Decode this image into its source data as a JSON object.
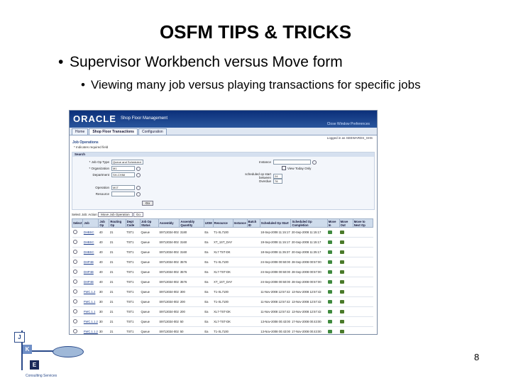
{
  "slide": {
    "title": "OSFM TIPS & TRICKS",
    "bullet1": "Supervisor Workbench versus Move form",
    "bullet2": "Viewing many job versus playing transactions for specific jobs",
    "bullet_char": "•",
    "page_number": "8"
  },
  "app": {
    "logo": "ORACLE",
    "title": "Shop Floor Management",
    "header_links": "Close Window   Preferences",
    "logged_in": "Logged in as  SEEWARDS_SHS",
    "tabs": [
      {
        "label": "Home",
        "active": false
      },
      {
        "label": "Shop Floor Transactions",
        "active": true
      },
      {
        "label": "Configuration",
        "active": false
      }
    ],
    "section_title": "Job Operations",
    "required_note": "* Indicates required field",
    "search": {
      "bar_label": "Search",
      "fields_left": [
        {
          "label": "* Job Op Type",
          "value": "Queue and Scheduled"
        },
        {
          "label": "* Organization",
          "value": "M1"
        },
        {
          "label": "Department",
          "value": "SH-CHIM"
        },
        {
          "label": "Operation",
          "value": "M1T"
        },
        {
          "label": "Resource",
          "value": ""
        }
      ],
      "fields_right": [
        {
          "label": "Instance",
          "value": ""
        },
        {
          "label": "scheduled op  start between",
          "value": "24"
        },
        {
          "label": "Overdue",
          "value": "78"
        }
      ],
      "checkbox_label": "View Today Only",
      "go_label": "Go"
    },
    "select_bar": {
      "label": "Select Job",
      "action_label": "Action",
      "action_value": "Move Job Operation",
      "go_label": "Go"
    },
    "table": {
      "headers": [
        "Select",
        "Job",
        "Job Op",
        "Routing Op",
        "Dept Code",
        "Job Op Status",
        "Assembly",
        "Assembly Quantity",
        "UOM",
        "Resource",
        "Instance",
        "Batch ID",
        "Scheduled Op Start",
        "Scheduled Op Completion",
        "Move In",
        "Move Out",
        "Move to Next Op"
      ],
      "rows": [
        {
          "job": "DHBSC",
          "op": "40",
          "rop": "21",
          "dept": "TST1",
          "status": "Queue",
          "assembly": "S9713034-002",
          "qty": "3180",
          "uom": "Ea",
          "resource": "T1-XL7100",
          "start": "18-Sep-2008 11:15:17",
          "end": "20-Sep-2008 11:15:17"
        },
        {
          "job": "DHBSC",
          "op": "40",
          "rop": "21",
          "dept": "TST1",
          "status": "Queue",
          "assembly": "S9713034-002",
          "qty": "3160",
          "uom": "Ea",
          "resource": "XT_1ST_DAY",
          "start": "19-Sep-2008 11:15:17",
          "end": "20-Sep-2008 11:15:17"
        },
        {
          "job": "DHBSC",
          "op": "40",
          "rop": "21",
          "dept": "TST1",
          "status": "Queue",
          "assembly": "S9713034-002",
          "qty": "3160",
          "uom": "Ea",
          "resource": "XL7 TST-DK",
          "start": "18-Sep-2008 11:35:37",
          "end": "20-Sep-2008 11:25:17"
        },
        {
          "job": "DHP4B",
          "op": "40",
          "rop": "21",
          "dept": "TST1",
          "status": "Queue",
          "assembly": "S9713034-002",
          "qty": "3576",
          "uom": "Ea",
          "resource": "T1-XL7100",
          "start": "24-Sep-2008 00:50:00",
          "end": "28-Sep-2008 00:57:00"
        },
        {
          "job": "DHP4B",
          "op": "40",
          "rop": "21",
          "dept": "TST1",
          "status": "Queue",
          "assembly": "S9713034-002",
          "qty": "3576",
          "uom": "Ea",
          "resource": "XL7-TST-DK",
          "start": "24-Sep-2008 00:50:00",
          "end": "28-Sep-2008 00:57:00"
        },
        {
          "job": "DHP4B",
          "op": "40",
          "rop": "21",
          "dept": "TST1",
          "status": "Queue",
          "assembly": "S9713034-002",
          "qty": "3576",
          "uom": "Ea",
          "resource": "XT_1ST_DAY",
          "start": "24-Sep-2008 00:50:00",
          "end": "28-Sep-2008 00:57:00"
        },
        {
          "job": "FWC.1.2",
          "op": "30",
          "rop": "21",
          "dept": "TST1",
          "status": "Queue",
          "assembly": "S9713034-002",
          "qty": "300",
          "uom": "Ea",
          "resource": "T1-XL7100",
          "start": "11-Nov-2008 12:57:42",
          "end": "13-Nov-2008 12:57:42"
        },
        {
          "job": "FWC.1.1",
          "op": "30",
          "rop": "21",
          "dept": "TST1",
          "status": "Queue",
          "assembly": "S9713034-002",
          "qty": "200",
          "uom": "Ea",
          "resource": "T1-XL7100",
          "start": "11-Nov-2008 12:57:42",
          "end": "13-Nov-2008 12:57:42"
        },
        {
          "job": "FWC.1.1",
          "op": "30",
          "rop": "21",
          "dept": "TST1",
          "status": "Queue",
          "assembly": "S9713034-002",
          "qty": "200",
          "uom": "Ea",
          "resource": "XL7-TST-DK",
          "start": "11-Nov-2008 12:57:42",
          "end": "13-Nov-2008 12:57:42"
        },
        {
          "job": "FWC.1.1.2",
          "op": "30",
          "rop": "21",
          "dept": "TST1",
          "status": "Queue",
          "assembly": "S9713034-002",
          "qty": "50",
          "uom": "Ea",
          "resource": "XL7-TST-DK",
          "start": "13-Nov-2008 00:43:00",
          "end": "17-Nov-2008 00:43:00"
        },
        {
          "job": "FWC.1.1.2",
          "op": "30",
          "rop": "21",
          "dept": "TST1",
          "status": "Queue",
          "assembly": "S9713034-002",
          "qty": "50",
          "uom": "Ea",
          "resource": "T1-XL7100",
          "start": "13-Nov-2008 00:43:00",
          "end": "17-Nov-2008 00:43:00"
        }
      ]
    }
  },
  "logo": {
    "letters": [
      "J",
      "K",
      "E"
    ],
    "tagline": "Consulting Services",
    "colors": {
      "j": "#ffffff",
      "k": "#2a4a8a",
      "e": "#1a2a5a"
    }
  }
}
